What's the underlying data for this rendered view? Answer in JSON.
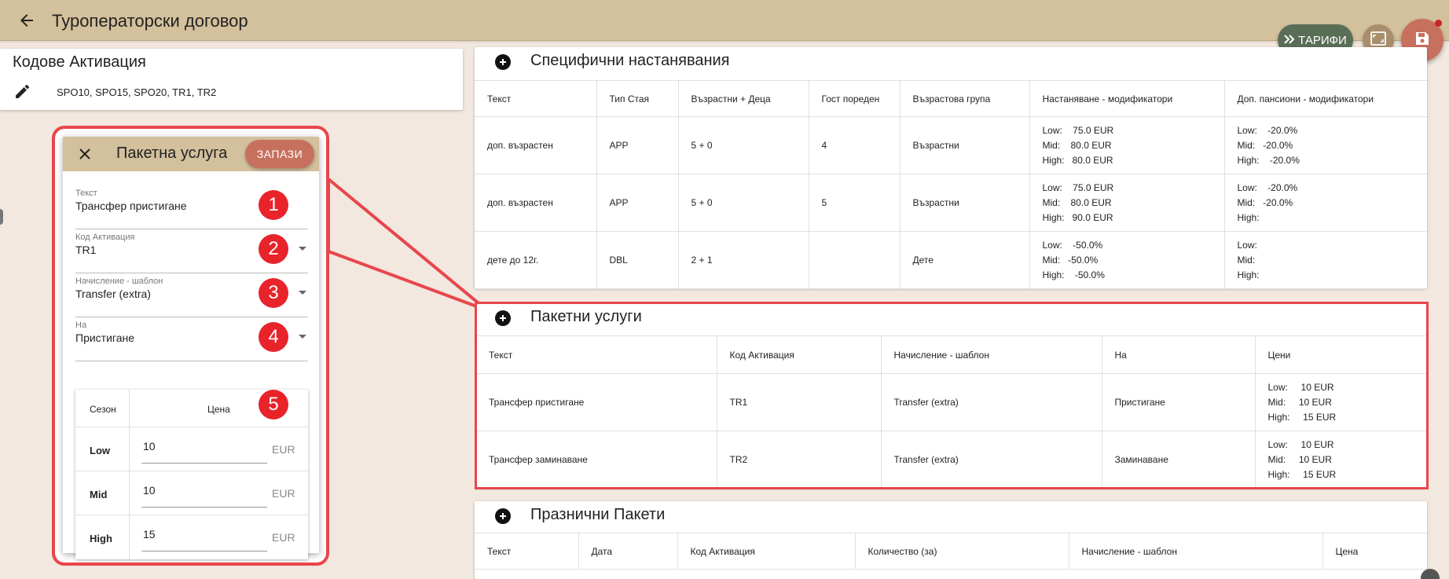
{
  "header": {
    "title": "Туроператорски договор",
    "tarifi_label": "ТАРИФИ"
  },
  "codes": {
    "title": "Кодове Активация",
    "value": "SPO10, SPO15, SPO20, TR1, TR2"
  },
  "dialog": {
    "title": "Пакетна услуга",
    "save_label": "ЗАПАЗИ",
    "fields": [
      {
        "label": "Текст",
        "value": "Трансфер пристигане",
        "badge": "1"
      },
      {
        "label": "Код Активация",
        "value": "TR1",
        "badge": "2"
      },
      {
        "label": "Начисление - шаблон",
        "value": "Transfer (extra)",
        "badge": "3"
      },
      {
        "label": "На",
        "value": "Пристигане",
        "badge": "4"
      }
    ],
    "prices": {
      "season_header": "Сезон",
      "price_header": "Цена",
      "badge": "5",
      "rows": [
        {
          "season": "Low",
          "value": "10",
          "currency": "EUR"
        },
        {
          "season": "Mid",
          "value": "10",
          "currency": "EUR"
        },
        {
          "season": "High",
          "value": "15",
          "currency": "EUR"
        }
      ]
    }
  },
  "specific": {
    "title": "Специфични настанявания",
    "headers": [
      "Текст",
      "Тип Стая",
      "Възрастни + Деца",
      "Гост пореден",
      "Възрастова група",
      "Настаняване - модификатори",
      "Доп. пансиони - модификатори"
    ],
    "rows": [
      {
        "text": "доп. възрастен",
        "room": "APP",
        "guests": "5 + 0",
        "order": "4",
        "group": "Възрастни",
        "mods": [
          "Low:    75.0 EUR",
          "Mid:    80.0 EUR",
          "High:   80.0 EUR"
        ],
        "board": [
          "Low:    -20.0%",
          "Mid:   -20.0%",
          "High:    -20.0%"
        ]
      },
      {
        "text": "доп. възрастен",
        "room": "APP",
        "guests": "5 + 0",
        "order": "5",
        "group": "Възрастни",
        "mods": [
          "Low:    75.0 EUR",
          "Mid:    80.0 EUR",
          "High:   90.0 EUR"
        ],
        "board": [
          "Low:    -20.0%",
          "Mid:   -20.0%",
          "High:"
        ]
      },
      {
        "text": "дете до 12г.",
        "room": "DBL",
        "guests": "2 + 1",
        "order": "",
        "group": "Дете",
        "mods": [
          "Low:    -50.0%",
          "Mid:   -50.0%",
          "High:    -50.0%"
        ],
        "board": [
          "Low:",
          "Mid:",
          "High:"
        ]
      }
    ]
  },
  "packages": {
    "title": "Пакетни услуги",
    "headers": [
      "Текст",
      "Код Активация",
      "Начисление - шаблон",
      "На",
      "Цени"
    ],
    "rows": [
      {
        "text": "Трансфер пристигане",
        "code": "TR1",
        "template": "Transfer (extra)",
        "on": "Пристигане",
        "prices": [
          "Low:     10 EUR",
          "Mid:     10 EUR",
          "High:     15 EUR"
        ]
      },
      {
        "text": "Трансфер заминаване",
        "code": "TR2",
        "template": "Transfer (extra)",
        "on": "Заминаване",
        "prices": [
          "Low:     10 EUR",
          "Mid:     10 EUR",
          "High:     15 EUR"
        ]
      }
    ]
  },
  "holidays": {
    "title": "Празнични Пакети",
    "headers": [
      "Текст",
      "Дата",
      "Код Активация",
      "Количество (за)",
      "Начисление - шаблон",
      "Цена"
    ]
  },
  "colors": {
    "topbar": "#d3c09c",
    "background": "#f2e8df",
    "accent": "#c8705e",
    "tarifi": "#5a6e57",
    "callout_red": "#e8464b"
  }
}
